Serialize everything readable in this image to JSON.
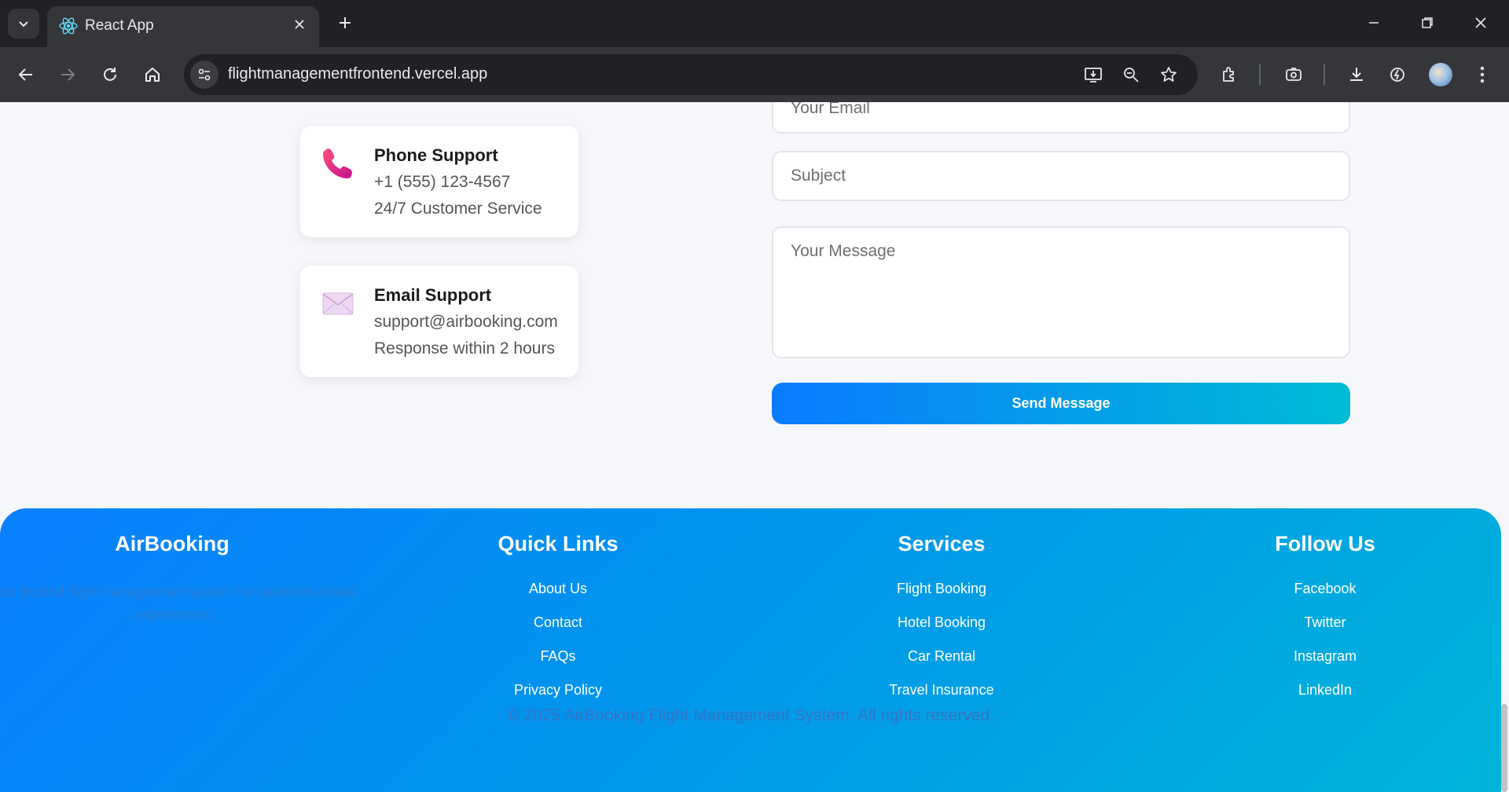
{
  "browser": {
    "tab_title": "React App",
    "url": "flightmanagementfrontend.vercel.app"
  },
  "contact_cards": [
    {
      "title": "Phone Support",
      "line1": "+1 (555) 123-4567",
      "line2": "24/7 Customer Service",
      "icon": "phone-icon"
    },
    {
      "title": "Email Support",
      "line1": "support@airbooking.com",
      "line2": "Response within 2 hours",
      "icon": "envelope-icon"
    }
  ],
  "form": {
    "email_placeholder": "Your Email",
    "subject_placeholder": "Subject",
    "message_placeholder": "Your Message",
    "submit_label": "Send Message"
  },
  "footer": {
    "brand": {
      "title": "AirBooking",
      "description": "Your trusted flight management system for seamless travel experiences"
    },
    "quick_links": {
      "title": "Quick Links",
      "items": [
        "About Us",
        "Contact",
        "FAQs",
        "Privacy Policy"
      ]
    },
    "services": {
      "title": "Services",
      "items": [
        "Flight Booking",
        "Hotel Booking",
        "Car Rental",
        "Travel Insurance"
      ]
    },
    "follow_us": {
      "title": "Follow Us",
      "items": [
        "Facebook",
        "Twitter",
        "Instagram",
        "LinkedIn"
      ]
    },
    "copyright": "© 2025 AirBooking Flight Management System. All rights reserved."
  },
  "colors": {
    "accent_start": "#0a7cff",
    "accent_end": "#00bcd4",
    "chrome_dark": "#202124",
    "chrome_toolbar": "#35363a"
  }
}
